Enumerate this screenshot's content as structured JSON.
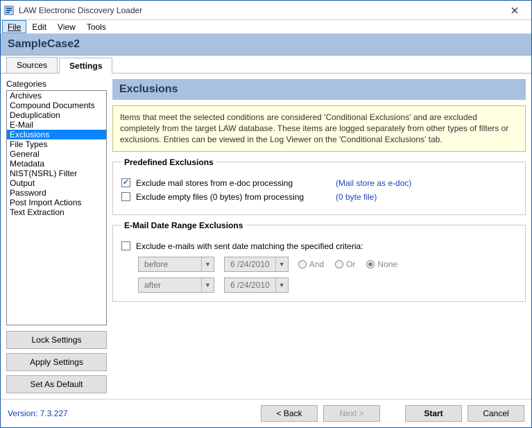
{
  "window": {
    "title": "LAW Electronic Discovery Loader"
  },
  "menubar": {
    "items": [
      {
        "label": "File",
        "active": true
      },
      {
        "label": "Edit"
      },
      {
        "label": "View"
      },
      {
        "label": "Tools"
      }
    ]
  },
  "case_name": "SampleCase2",
  "tabs": [
    {
      "label": "Sources",
      "active": false
    },
    {
      "label": "Settings",
      "active": true
    }
  ],
  "categories": {
    "label": "Categories",
    "items": [
      "Archives",
      "Compound Documents",
      "Deduplication",
      "E-Mail",
      "Exclusions",
      "File Types",
      "General",
      "Metadata",
      "NIST(NSRL) Filter",
      "Output",
      "Password",
      "Post Import Actions",
      "Text Extraction"
    ],
    "selected_index": 4
  },
  "left_buttons": {
    "lock": "Lock Settings",
    "apply": "Apply Settings",
    "default": "Set As Default"
  },
  "panel": {
    "title": "Exclusions",
    "info": "Items that meet the selected conditions are considered 'Conditional  Exclusions' and are excluded completely from the target LAW database.  These items are logged separately from other types of filters or exclusions.  Entries can be viewed in the Log Viewer on the 'Conditional Exclusions' tab.",
    "predefined": {
      "legend": "Predefined Exclusions",
      "opt1": {
        "checked": true,
        "label": "Exclude mail stores from e-doc processing",
        "link": "(Mail store as e-doc)"
      },
      "opt2": {
        "checked": false,
        "label": "Exclude empty files (0 bytes) from processing",
        "link": "(0 byte file)"
      }
    },
    "daterange": {
      "legend": "E-Mail  Date Range Exclusions",
      "main": {
        "checked": false,
        "label": "Exclude e-mails with sent date matching the specified criteria:"
      },
      "row1": {
        "combo": "before",
        "date": "6 /24/2010"
      },
      "row2": {
        "combo": "after",
        "date": "6 /24/2010"
      },
      "radios": {
        "and": "And",
        "or": "Or",
        "none": "None",
        "selected": "none"
      }
    }
  },
  "footer": {
    "version": "Version: 7.3.227",
    "back": "< Back",
    "next": "Next >",
    "start": "Start",
    "cancel": "Cancel"
  }
}
